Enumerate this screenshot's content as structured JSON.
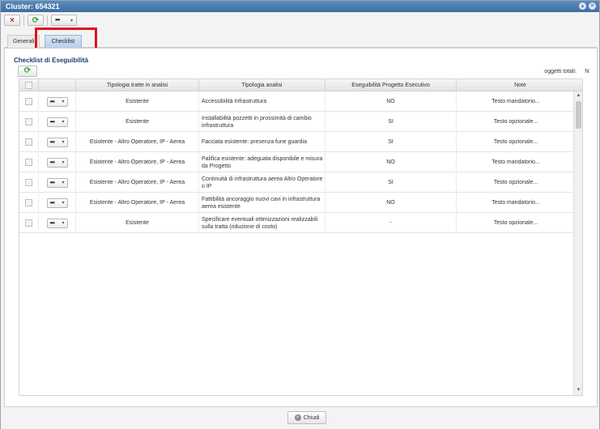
{
  "window": {
    "title": "Cluster: 654321"
  },
  "title_controls": [
    "▴",
    "✕"
  ],
  "toolbar": {
    "delete_icon": "×",
    "refresh_icon": "⟳",
    "more_dots": "•••",
    "caret": "▾"
  },
  "tabs": [
    {
      "label": "Generali",
      "active": false
    },
    {
      "label": "Checklist",
      "active": true
    }
  ],
  "section": {
    "title": "Checklist di Eseguibilità",
    "totals_label": "oggetti totali:",
    "totals_value": "N"
  },
  "grid": {
    "headers": [
      "",
      "",
      "Tipologia tratte in analisi",
      "Tipologia analisi",
      "Eseguibilità Progetto Esecutivo",
      "Note"
    ],
    "rows": [
      {
        "tratta": "Esistente",
        "analisi": "Accessibilità Infrastruttura",
        "eseguibilita": "NO",
        "note": "Testo mandatorio..."
      },
      {
        "tratta": "Esistente",
        "analisi": "Installabilità pozzetti in prossimità di cambio infrastruttura",
        "eseguibilita": "SI",
        "note": "Testo opzionale..."
      },
      {
        "tratta": "Esistente - Altro Operatore, IP - Aerea",
        "analisi": "Facciata esistente: presenza fune guardia",
        "eseguibilita": "SI",
        "note": "Testo opzionale..."
      },
      {
        "tratta": "Esistente - Altro Operatore, IP - Aerea",
        "analisi": "Palifica esistente: adeguata disponibile e misura da Progetto",
        "eseguibilita": "NO",
        "note": "Testo mandatorio..."
      },
      {
        "tratta": "Esistente - Altro Operatore, IP - Aerea",
        "analisi": "Continuità di infrastruttura aerea Altro Operatore o IP",
        "eseguibilita": "SI",
        "note": "Testo opzionale..."
      },
      {
        "tratta": "Esistente - Altro Operatore, IP - Aerea",
        "analisi": "Fattibilità ancoraggio nuovi cavi in infrastruttura aerea esistente",
        "eseguibilita": "NO",
        "note": "Testo mandatorio..."
      },
      {
        "tratta": "Esistente",
        "analisi": "Specificare eventuali ottimizzazioni realizzabili sulla tratta (riduzione di costo)",
        "eseguibilita": "-",
        "note": "Testo opzionale..."
      }
    ]
  },
  "footer": {
    "close_label": "Chiudi",
    "close_icon": "×"
  }
}
